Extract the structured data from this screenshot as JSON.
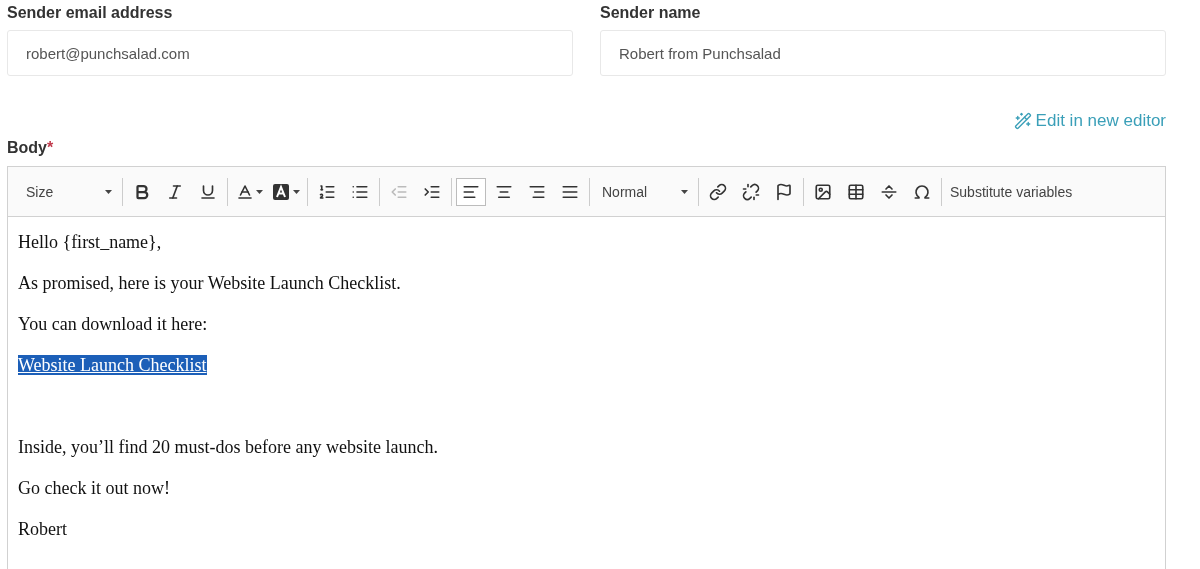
{
  "sender_fields": [
    {
      "label": "Sender email address",
      "value": "robert@punchsalad.com"
    },
    {
      "label": "Sender name",
      "value": "Robert from Punchsalad"
    }
  ],
  "edit_link": {
    "label": "Edit in new editor"
  },
  "body": {
    "label": "Body",
    "required_mark": "*",
    "toolbar": [
      [
        {
          "kind": "dropdown",
          "label": "Size"
        }
      ],
      [
        {
          "kind": "bold",
          "disabled": false
        },
        {
          "kind": "italic",
          "disabled": false
        },
        {
          "kind": "underline",
          "disabled": false
        }
      ],
      [
        {
          "kind": "text-color",
          "disabled": false
        },
        {
          "kind": "background-color",
          "disabled": false
        }
      ],
      [
        {
          "kind": "numbered-list",
          "disabled": false
        },
        {
          "kind": "bullet-list",
          "disabled": false
        }
      ],
      [
        {
          "kind": "outdent",
          "disabled": true
        },
        {
          "kind": "indent",
          "disabled": false
        }
      ],
      [
        {
          "kind": "align-left",
          "disabled": false,
          "selected": true
        },
        {
          "kind": "align-center",
          "disabled": false,
          "selected": false
        },
        {
          "kind": "align-right",
          "disabled": false,
          "selected": false
        },
        {
          "kind": "align-justify",
          "disabled": false,
          "selected": false
        }
      ],
      [
        {
          "kind": "dropdown",
          "label": "Normal"
        }
      ],
      [
        {
          "kind": "link",
          "disabled": false
        },
        {
          "kind": "unlink",
          "disabled": false
        },
        {
          "kind": "anchor",
          "disabled": false
        }
      ],
      [
        {
          "kind": "image",
          "disabled": false
        },
        {
          "kind": "table",
          "disabled": false
        },
        {
          "kind": "horizontal-rule",
          "disabled": false
        },
        {
          "kind": "special-character",
          "disabled": false
        }
      ],
      [
        {
          "kind": "text-button",
          "label": "Substitute variables"
        }
      ]
    ],
    "paragraphs": [
      {
        "kind": "text",
        "text": "Hello {first_name},"
      },
      {
        "kind": "text",
        "text": "As promised, here is your Website Launch Checklist."
      },
      {
        "kind": "text",
        "text": "You can download it here:"
      },
      {
        "kind": "link",
        "text": "Website Launch Checklist",
        "selected": true
      },
      {
        "kind": "text",
        "text": "Inside, you’ll find 20 must-dos before any website launch."
      },
      {
        "kind": "text",
        "text": "Go check it out now!"
      },
      {
        "kind": "text",
        "text": "Robert"
      }
    ]
  }
}
